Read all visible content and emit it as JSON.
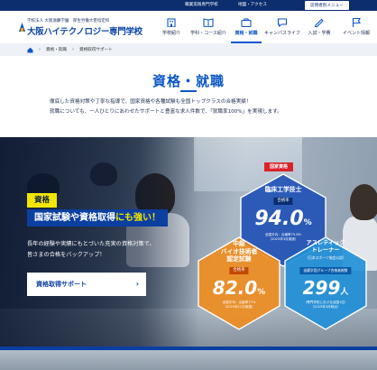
{
  "topbar": {
    "link_general": "職業実践専門学校",
    "link_access": "地図・アクセス",
    "visitor_menu": "訪問者別メニュー"
  },
  "logo": {
    "subtitle": "学校法人 大阪滋慶学園　厚生労働大臣指定校",
    "name": "大阪ハイテクノロジー専門学校"
  },
  "nav": [
    {
      "label": "学校紹介",
      "icon": "building-icon"
    },
    {
      "label": "学科・コース紹介",
      "icon": "book-icon"
    },
    {
      "label": "資格・就職",
      "icon": "briefcase-icon",
      "active": true
    },
    {
      "label": "キャンパスライフ",
      "icon": "chat-icon"
    },
    {
      "label": "入試・学費",
      "icon": "pencil-icon"
    },
    {
      "label": "イベント情報",
      "icon": "flag-icon"
    }
  ],
  "breadcrumb": [
    "資格・就職",
    "資格取得サポート"
  ],
  "page": {
    "title": "資格・就職",
    "lead_1": "徹底した資格対策や丁寧な指導で、国家資格や各種試験も全国トップクラスの合格実績！",
    "lead_2": "就職についても、一人ひとりにあわせたサポートと豊富な求人件数で、「就職率100%」を実現します。"
  },
  "hero": {
    "tag": "資格",
    "headline_prefix": "国家試験や資格取得",
    "headline_suffix": "にも強い！",
    "text_1": "長年の経験や実績にもとづいた充実の資格対策で、",
    "text_2": "皆さまの合格をバックアップ！",
    "button": "資格取得サポート"
  },
  "stats": {
    "hex1": {
      "tab": "国家資格",
      "title": "臨床工学技士",
      "badge": "合格率",
      "value": "94.0",
      "unit": "%",
      "note_1": "全国平均：合格率75.8%",
      "note_2": "（2025年3月実施）"
    },
    "hex2": {
      "title_1": "中級",
      "title_2": "バイオ技術者",
      "title_3": "認定試験",
      "badge": "合格率",
      "value": "82.0",
      "unit": "%",
      "note_1": "全国平均：合格率77%",
      "note_2": "（2024年12月実施）"
    },
    "hex3": {
      "title_1": "アスレティック",
      "title_2": "トレーナー",
      "title_3": "（日本スポーツ協会公認）",
      "badge": "滋慶学園グループ合格者総数",
      "value": "299",
      "unit": "人",
      "note_1": "（専門学校における全国1位）",
      "note_2": "（2025年3月時点）"
    }
  },
  "colors": {
    "brand": "#0b57c8",
    "navy": "#0a2e6e",
    "hex1": "#1b4fb5",
    "hex2": "#f08c1e",
    "hex3": "#1f8fd8",
    "accent": "#f2e600",
    "tab_red": "#d8232a"
  }
}
